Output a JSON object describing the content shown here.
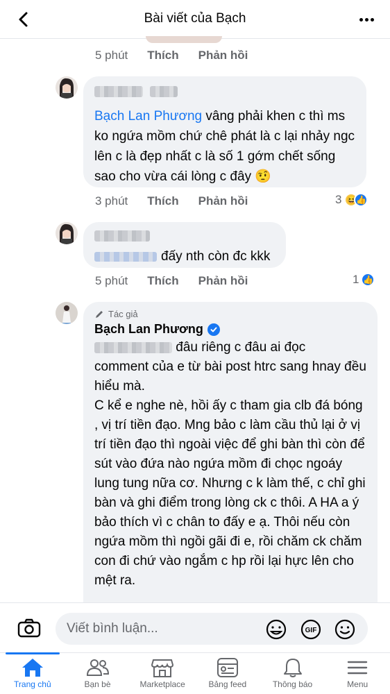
{
  "header": {
    "title": "Bài viết của Bạch"
  },
  "comments": [
    {
      "time": "5 phút",
      "like_label": "Thích",
      "reply_label": "Phản hồi"
    },
    {
      "tag": "Bạch Lan Phương",
      "text_line1": " vâng phải khen c thì",
      "text_rest": "ms ko ngứa mồm chứ chê phát là c lại nhảy ngc lên c là đẹp nhất c là số 1 gớm chết sống sao cho vừa cái lòng c đây 🤨",
      "time": "3 phút",
      "like_label": "Thích",
      "reply_label": "Phản hồi",
      "reaction_count": "3"
    },
    {
      "text": "đấy nth còn đc kkk",
      "time": "5 phút",
      "like_label": "Thích",
      "reply_label": "Phản hồi",
      "reaction_count": "1"
    }
  ],
  "author_comment": {
    "badge": "Tác giả",
    "name": "Bạch Lan Phương",
    "text_line1": " đâu riêng c đâu ai đọc",
    "text_rest": "comment của e từ bài post htrc sang hnay đều hiểu mà.\nC kể e nghe nè, hồi ấy c tham gia clb đá bóng , vị trí tiền đạo. Mng bảo  c làm cầu thủ lại ở vị trí tiền đạo thì ngoài việc để ghi bàn thì còn để sút vào đứa nào ngứa mồm đi chọc ngoáy lung tung nữa cơ. Nhưng c k làm thế, c chỉ ghi bàn và ghi điểm trong lòng ck c thôi. A HA a ý bảo thích vì c chân to đấy e ạ. Thôi nếu còn ngứa mồm thì ngồi gãi đi e, rồi chăm ck chăm con đi chứ vào ngắm c hp rồi lại hực lên cho mệt ra."
  },
  "input": {
    "placeholder": "Viết bình luận..."
  },
  "nav": [
    {
      "label": "Trang chủ",
      "icon": "home-icon",
      "active": true
    },
    {
      "label": "Bạn bè",
      "icon": "friends-icon"
    },
    {
      "label": "Marketplace",
      "icon": "marketplace-icon"
    },
    {
      "label": "Bảng feed",
      "icon": "feed-icon"
    },
    {
      "label": "Thông báo",
      "icon": "bell-icon"
    },
    {
      "label": "Menu",
      "icon": "menu-icon"
    }
  ],
  "colors": {
    "accent": "#1877f2",
    "bubble": "#f0f2f5",
    "muted": "#65676b"
  }
}
